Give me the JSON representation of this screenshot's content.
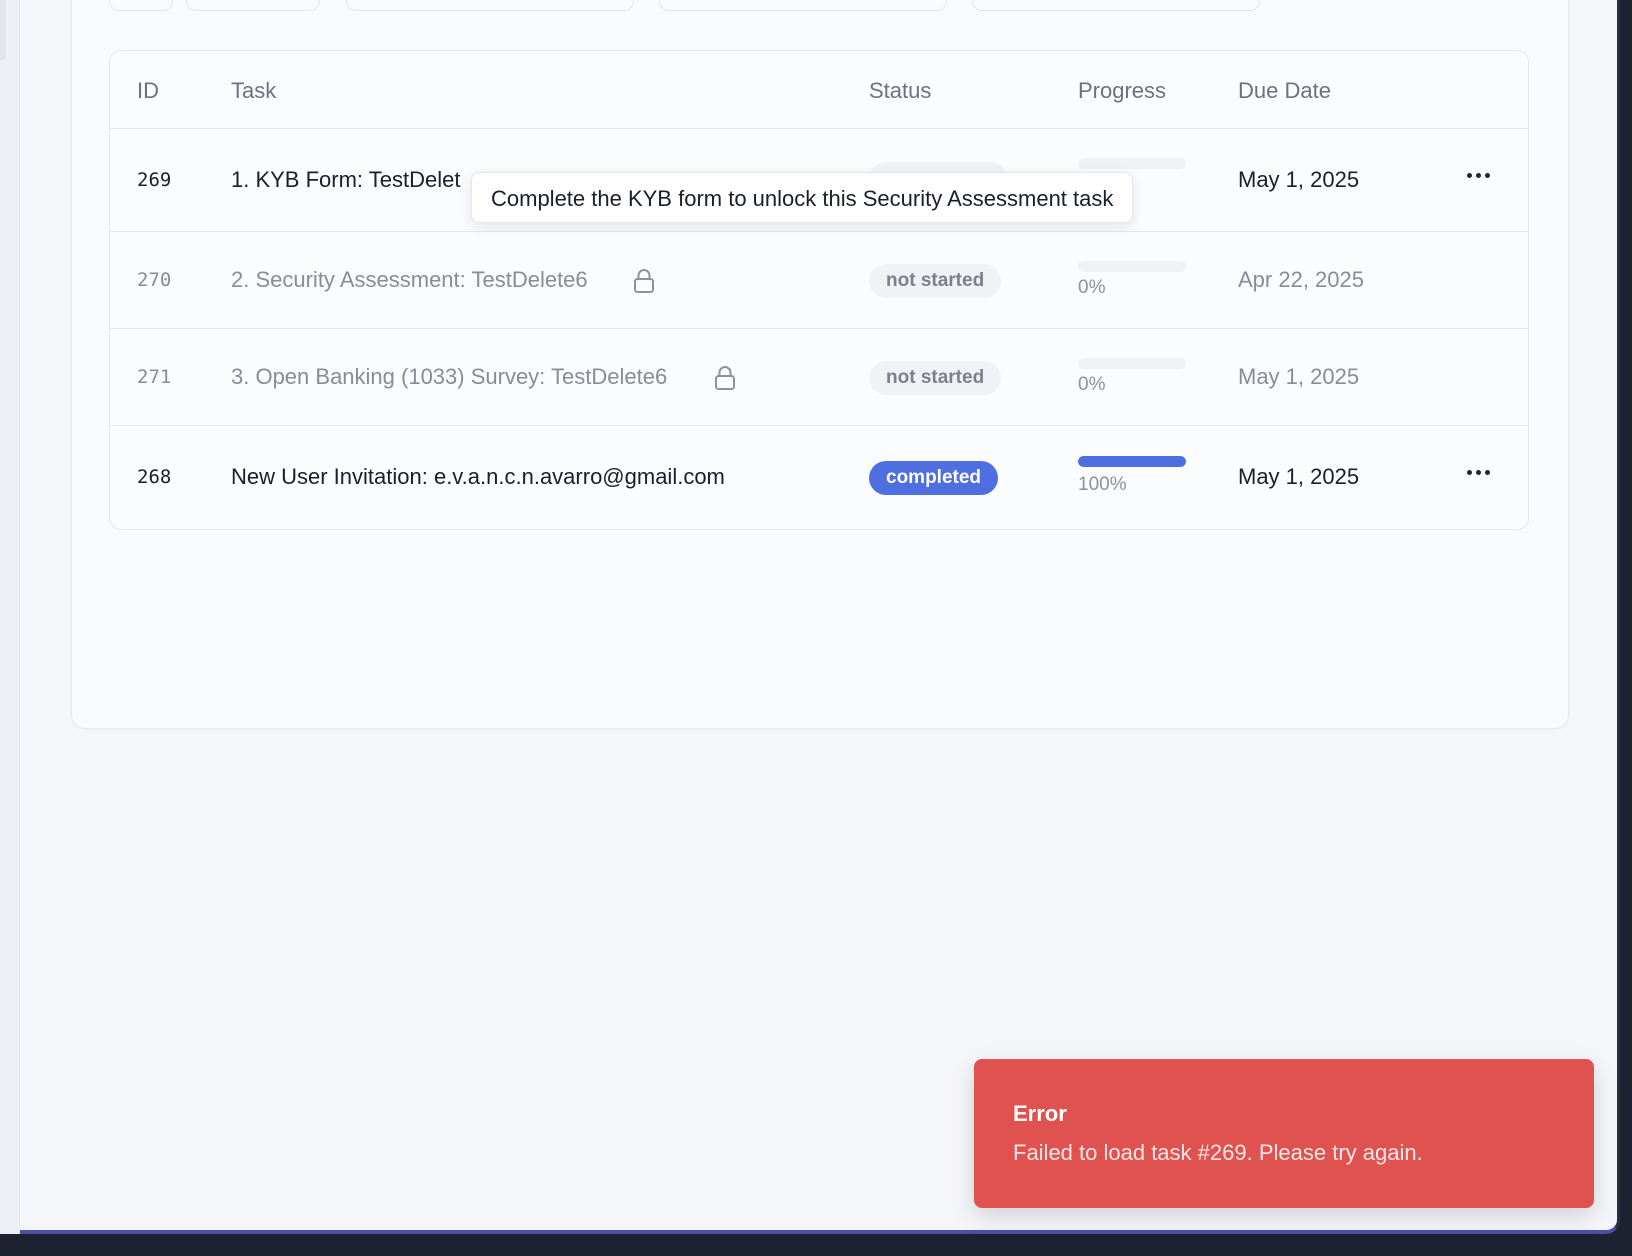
{
  "table": {
    "columns": {
      "id": "ID",
      "task": "Task",
      "status": "Status",
      "progress": "Progress",
      "due_date": "Due Date"
    },
    "rows": [
      {
        "id": "269",
        "task": "1. KYB Form: TestDelet",
        "status": "",
        "progress": 0,
        "progress_label": "",
        "due_date": "May 1, 2025",
        "locked": false,
        "has_menu": true
      },
      {
        "id": "270",
        "task": "2. Security Assessment: TestDelete6",
        "status": "not started",
        "progress": 0,
        "progress_label": "0%",
        "due_date": "Apr 22, 2025",
        "locked": true,
        "has_menu": false
      },
      {
        "id": "271",
        "task": "3. Open Banking (1033) Survey: TestDelete6",
        "status": "not started",
        "progress": 0,
        "progress_label": "0%",
        "due_date": "May 1, 2025",
        "locked": true,
        "has_menu": false
      },
      {
        "id": "268",
        "task": "New User Invitation: e.v.a.n.c.n.avarro@gmail.com",
        "status": "completed",
        "progress": 100,
        "progress_label": "100%",
        "due_date": "May 1, 2025",
        "locked": false,
        "has_menu": true
      }
    ]
  },
  "tooltip": {
    "text": "Complete the KYB form to unlock this Security Assessment task"
  },
  "toast": {
    "title": "Error",
    "message": "Failed to load task #269. Please try again."
  },
  "icons": {
    "lock": "lock-icon",
    "menu": "more-horizontal-icon"
  },
  "colors": {
    "accent": "#4f6ee0",
    "error": "#e0524f"
  }
}
